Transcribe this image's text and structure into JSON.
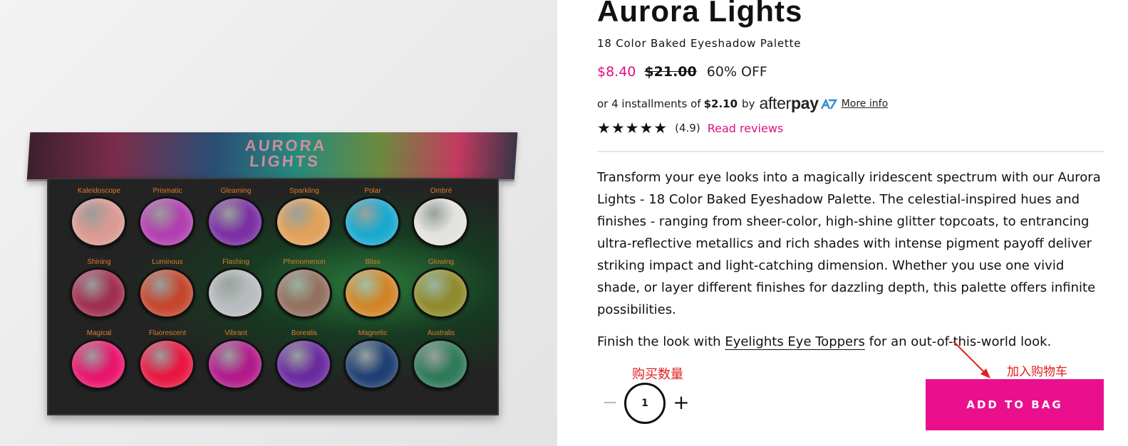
{
  "product": {
    "title": "Aurora Lights",
    "subtitle": "18 Color Baked Eyeshadow Palette",
    "lid_text": "AURORA LIGHTS",
    "price_sale": "$8.40",
    "price_original": "$21.00",
    "discount": "60% OFF",
    "afterpay": {
      "prefix": "or 4 installments of",
      "amount": "$2.10",
      "by": "by",
      "brand_light": "after",
      "brand_bold": "pay",
      "more_info": "More info"
    },
    "rating": {
      "stars": "★★★★★",
      "value": "(4.9)",
      "stars_count": 5,
      "reviews_link": "Read reviews"
    },
    "description": "Transform your eye looks into a magically iridescent spectrum with our Aurora Lights - 18 Color Baked Eyeshadow Palette. The celestial-inspired hues and finishes - ranging from sheer-color, high-shine glitter topcoats, to entrancing ultra-reflective metallics and rich shades with intense pigment payoff deliver striking impact and light-catching dimension. Whether you use one vivid shade, or layer different finishes for dazzling depth, this palette offers infinite possibilities.",
    "finish": {
      "before": "Finish the look with",
      "link": "Eyelights Eye Toppers",
      "after": "for an out-of-this-world look."
    }
  },
  "palette": {
    "shades": [
      {
        "name": "Kaleidoscope",
        "color": "#d99a92"
      },
      {
        "name": "Prismatic",
        "color": "#b13fb0"
      },
      {
        "name": "Gleaming",
        "color": "#7a2fa3"
      },
      {
        "name": "Sparkling",
        "color": "#e0a15a"
      },
      {
        "name": "Polar",
        "color": "#1aa9d0"
      },
      {
        "name": "Ombré",
        "color": "#e4e2de"
      },
      {
        "name": "Shining",
        "color": "#a02f50"
      },
      {
        "name": "Luminous",
        "color": "#c4462e"
      },
      {
        "name": "Flashing",
        "color": "#b9bcbf"
      },
      {
        "name": "Phenomenon",
        "color": "#94705e"
      },
      {
        "name": "Bliss",
        "color": "#d08628"
      },
      {
        "name": "Glowing",
        "color": "#8f8a2c"
      },
      {
        "name": "Magical",
        "color": "#e8156d"
      },
      {
        "name": "Fluorescent",
        "color": "#e8173f"
      },
      {
        "name": "Vibrant",
        "color": "#b21a8a"
      },
      {
        "name": "Borealis",
        "color": "#6a2aa0"
      },
      {
        "name": "Magnetic",
        "color": "#1e3f72"
      },
      {
        "name": "Australis",
        "color": "#2e7a5a"
      }
    ]
  },
  "purchase": {
    "quantity_label": "购买数量",
    "quantity": "1",
    "minus": "−",
    "plus": "+",
    "add_to_bag": "ADD TO BAG",
    "add_to_cart_label": "加入购物车"
  },
  "colors": {
    "accent": "#ea108d",
    "annotation": "#e02020"
  }
}
